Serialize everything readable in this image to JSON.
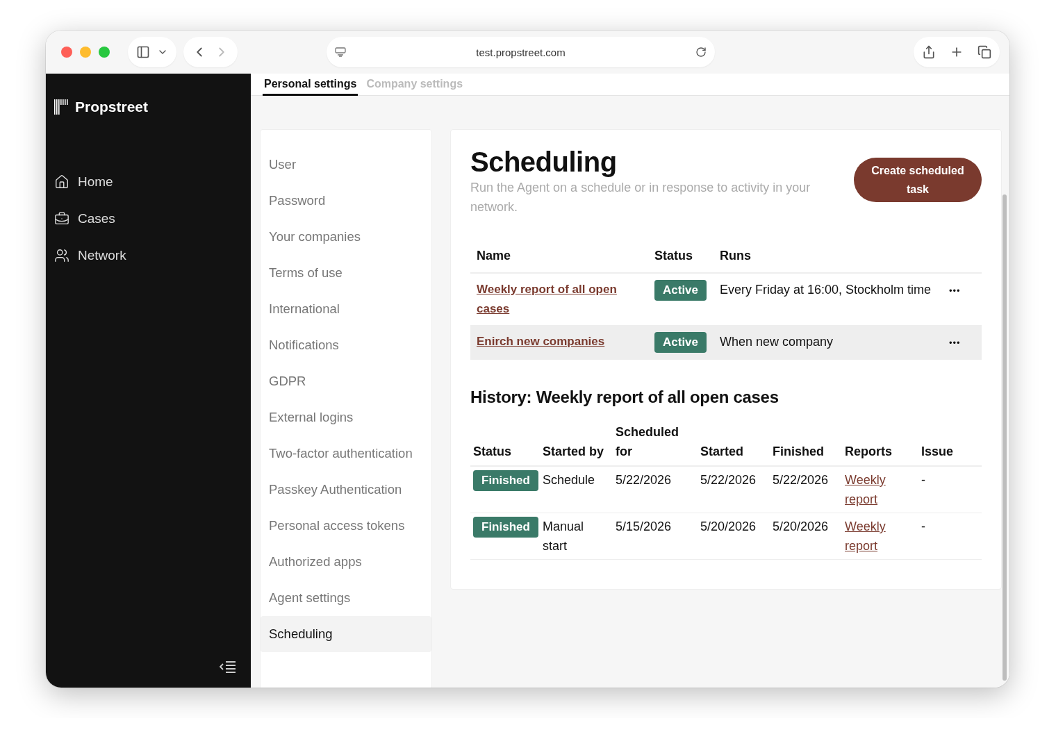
{
  "browser": {
    "url": "test.propstreet.com"
  },
  "sidebar": {
    "brand": "Propstreet",
    "items": [
      {
        "kind": "home",
        "label": "Home"
      },
      {
        "kind": "cases",
        "label": "Cases"
      },
      {
        "kind": "network",
        "label": "Network"
      }
    ]
  },
  "settings_tabs": [
    {
      "label": "Personal settings",
      "selected": true
    },
    {
      "label": "Company settings",
      "selected": false
    }
  ],
  "settings_menu": [
    {
      "label": "User",
      "selected": false
    },
    {
      "label": "Password",
      "selected": false
    },
    {
      "label": "Your companies",
      "selected": false
    },
    {
      "label": "Terms of use",
      "selected": false
    },
    {
      "label": "International",
      "selected": false
    },
    {
      "label": "Notifications",
      "selected": false
    },
    {
      "label": "GDPR",
      "selected": false
    },
    {
      "label": "External logins",
      "selected": false
    },
    {
      "label": "Two-factor authentication",
      "selected": false
    },
    {
      "label": "Passkey Authentication",
      "selected": false
    },
    {
      "label": "Personal access tokens",
      "selected": false
    },
    {
      "label": "Authorized apps",
      "selected": false
    },
    {
      "label": "Agent settings",
      "selected": false
    },
    {
      "label": "Scheduling",
      "selected": true
    }
  ],
  "scheduling": {
    "title": "Scheduling",
    "description": "Run the Agent on a schedule or in response to activity in your network.",
    "create_button": "Create scheduled task",
    "columns": [
      "Name",
      "Status",
      "Runs"
    ],
    "rows": [
      {
        "name": "Weekly report of all open cases",
        "status": "Active",
        "runs": "Every Friday at 16:00, Stockholm time",
        "menu": "•••",
        "highlighted": false
      },
      {
        "name": "Enirch new companies",
        "status": "Active",
        "runs": "When new company",
        "menu": "•••",
        "highlighted": true
      }
    ]
  },
  "history": {
    "title": "History: Weekly report of all open cases",
    "columns": [
      "Status",
      "Started by",
      "Scheduled for",
      "Started",
      "Finished",
      "Reports",
      "Issue"
    ],
    "rows": [
      {
        "status": "Finished",
        "started_by": "Schedule",
        "scheduled_for": "5/22/2026",
        "started": "5/22/2026",
        "finished": "5/22/2026",
        "report": "Weekly report",
        "issue": "-"
      },
      {
        "status": "Finished",
        "started_by": "Manual start",
        "scheduled_for": "5/15/2026",
        "started": "5/20/2026",
        "finished": "5/20/2026",
        "report": "Weekly report",
        "issue": "-"
      }
    ]
  }
}
